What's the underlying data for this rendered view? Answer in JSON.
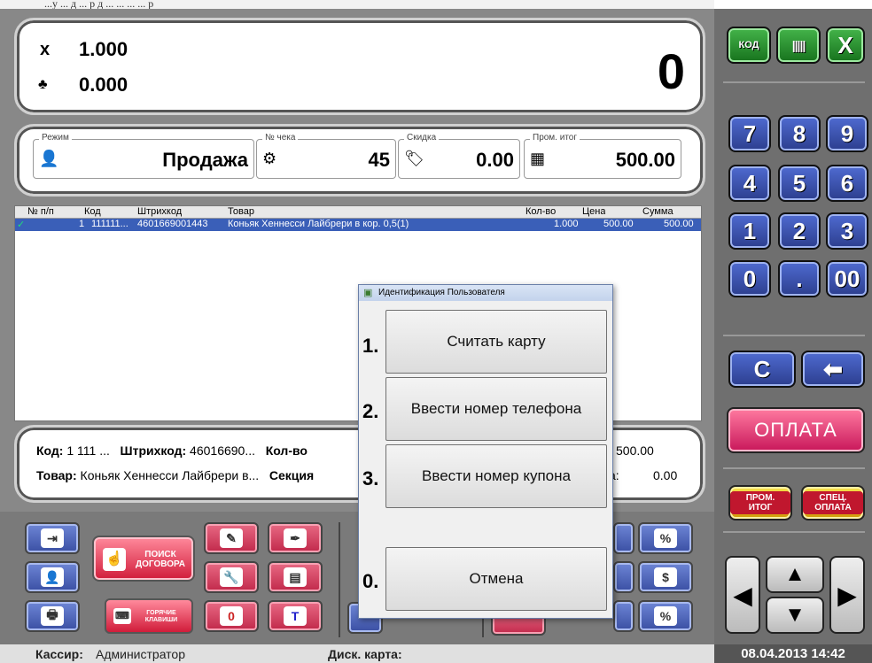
{
  "top_strip": {
    "text": "  ...у  ...   д   ...  р  д   ...   ...   ...   ...   р"
  },
  "quantity": {
    "qty_symbol": "x",
    "qty_value": "1.000",
    "weight_value": "0.000",
    "total": "0"
  },
  "info": {
    "mode_label": "Режим",
    "mode_value": "Продажа",
    "check_label": "№ чека",
    "check_value": "45",
    "discount_label": "Скидка",
    "discount_value": "0.00",
    "subtotal_label": "Пром. итог",
    "subtotal_value": "500.00"
  },
  "grid": {
    "headers": [
      "№ п/п",
      "Код",
      "Штрихкод",
      "Товар",
      "Кол-во",
      "Цена",
      "Сумма"
    ],
    "rows": [
      {
        "num": "1",
        "code": "111111...",
        "barcode": "4601669001443",
        "product": "Коньяк Хеннесси Лайбрери в кор. 0,5(1)",
        "qty": "1.000",
        "price": "500.00",
        "sum": "500.00"
      }
    ]
  },
  "detail": {
    "code_label": "Код:",
    "code_value": "1 111 ...",
    "barcode_label": "Штрихкод:",
    "barcode_value": "46016690...",
    "qty_label": "Кол-во",
    "sum_fragment": "500.00",
    "product_label": "Товар:",
    "product_value": "Коньяк Хеннесси Лайбрери в...",
    "section_label": "Секция",
    "discount_fragment": "а:",
    "discount_value": "0.00"
  },
  "buttons": {
    "search_contract": "ПОИСК ДОГОВОРА",
    "hot_keys": "ГОРЯЧИЕ КЛАВИШИ"
  },
  "keypad": {
    "code": "КОД",
    "cancel": "X",
    "digits": [
      "7",
      "8",
      "9",
      "4",
      "5",
      "6",
      "1",
      "2",
      "3",
      "0",
      ".",
      "00"
    ],
    "clear": "С",
    "pay": "ОПЛАТА",
    "subtotal": "ПРОМ. ИТОГ",
    "special_pay": "СПЕЦ. ОПЛАТА"
  },
  "dialog": {
    "title": "Идентификация Пользователя",
    "options": [
      {
        "num": "1.",
        "label": "Считать карту"
      },
      {
        "num": "2.",
        "label": "Ввести номер телефона"
      },
      {
        "num": "3.",
        "label": "Ввести номер купона"
      },
      {
        "num": "0.",
        "label": "Отмена"
      }
    ]
  },
  "status": {
    "cashier_label": "Кассир:",
    "cashier_value": "Администратор",
    "card_label": "Диск. карта:",
    "datetime": "08.04.2013 14:42"
  }
}
